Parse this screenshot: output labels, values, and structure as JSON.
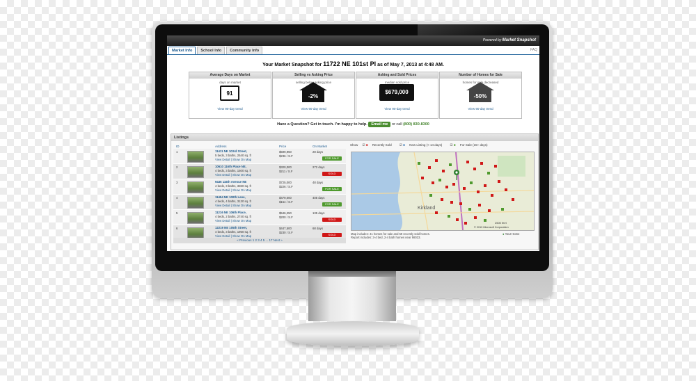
{
  "brand": {
    "powered_by": "Powered by",
    "name": "Market Snapshot"
  },
  "tabs": [
    {
      "label": "Market Info",
      "active": true
    },
    {
      "label": "School Info",
      "active": false
    },
    {
      "label": "Community Info",
      "active": false
    }
  ],
  "tab_right_text": "FAQ",
  "headline": {
    "prefix": "Your Market Snapshot for",
    "address": "11722 NE 101st Pl",
    "middle": "as of May 7, 2013",
    "at": "at 4:48 AM."
  },
  "cards": [
    {
      "title": "Average Days on Market",
      "sub": "days on market",
      "value": "91",
      "link": "View 90-day trend"
    },
    {
      "title": "Selling vs Asking Price",
      "sub": "selling below asking price",
      "value": "-2%",
      "link": "View 90-day trend"
    },
    {
      "title": "Asking and Sold Prices",
      "sub": "median sold price",
      "value": "$679,000",
      "link": "View 90-day trend"
    },
    {
      "title": "Number of Homes for Sale",
      "sub": "homes for sale decreased",
      "value": "-50%",
      "link": "View 90-day trend"
    }
  ],
  "contact": {
    "question": "Have a Question? Get in touch. I'm happy to help.",
    "email_button": "Email me",
    "or_call": "or call",
    "phone": "(800) 830-8300"
  },
  "listings": {
    "panel_title": "Listings",
    "columns": [
      "ID",
      "Address",
      "Price",
      "On Market"
    ],
    "rows": [
      {
        "num": "1",
        "address": "11411 NE 103rd Street,",
        "details": "5 beds, 3 baths, 2540 sq. ft",
        "price": "$599,950",
        "per_sf": "$236 / S.F",
        "days": "28 days",
        "status": "FOR SALE",
        "status_color": "#4f9a2e"
      },
      {
        "num": "2",
        "address": "10610 116th Place NE,",
        "details": "4 beds, 3 baths, 1500 sq. ft",
        "price": "$320,000",
        "per_sf": "$211 / S.F",
        "days": "272 days",
        "status": "SOLD",
        "status_color": "#d01818"
      },
      {
        "num": "3",
        "address": "9436 116th Avenue NE",
        "details": "4 beds, 3 baths, 3360 sq. ft",
        "price": "$725,000",
        "per_sf": "$226 / S.F",
        "days": "48 days",
        "status": "FOR SALE",
        "status_color": "#4f9a2e"
      },
      {
        "num": "4",
        "address": "11454 NE 100th Lane,",
        "details": "4 beds, 4 baths, 3130 sq. ft",
        "price": "$479,000",
        "per_sf": "$154 / S.F",
        "days": "405 days",
        "status": "FOR SALE",
        "status_color": "#4f9a2e"
      },
      {
        "num": "5",
        "address": "11216 NE 106th Place,",
        "details": "4 beds, 2 baths, 2740 sq. ft",
        "price": "$546,250",
        "per_sf": "$200 / S.F",
        "days": "135 days",
        "status": "SOLD",
        "status_color": "#d01818"
      },
      {
        "num": "6",
        "address": "12219 NE 105th Street,",
        "details": "4 beds, 3 baths, 1950 sq. ft",
        "price": "$447,500",
        "per_sf": "$230 / S.F",
        "days": "68 days",
        "status": "SOLD",
        "status_color": "#d01818"
      }
    ],
    "view_detail": "View Detail",
    "show_on_map": "Show On Map",
    "pager": "« Previous   1  2  3  4  5  ...  17  Next »"
  },
  "map": {
    "show_label": "Show",
    "filters": [
      "Recently Sold",
      "New Listing (< 14 days)",
      "For Sale (15+ days)"
    ],
    "town": "Kirkland",
    "scale": "2500 feet",
    "copyright": "© 2013 Microsoft Corporation",
    "notes": [
      "Map includes: 41 homes for sale and 59 recently sold homes.",
      "Report includes: 3-4 bed, 2-4 bath homes near 98033."
    ],
    "your_home": "Your Home"
  }
}
